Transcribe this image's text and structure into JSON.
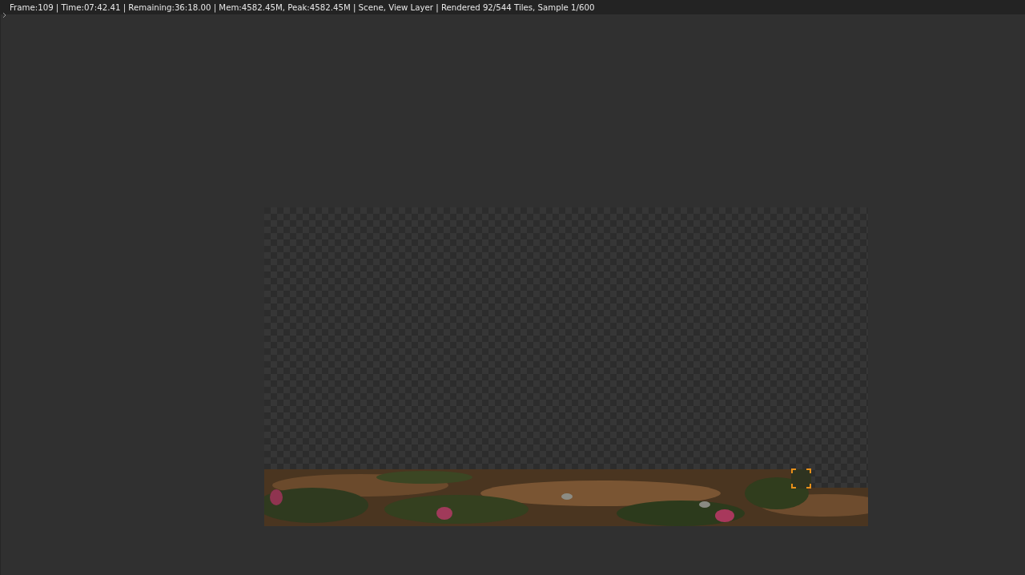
{
  "status_bar": {
    "text": "Frame:109 | Time:07:42.41 | Remaining:36:18.00 | Mem:4582.45M, Peak:4582.45M | Scene, View Layer | Rendered 92/544 Tiles, Sample 1/600"
  }
}
